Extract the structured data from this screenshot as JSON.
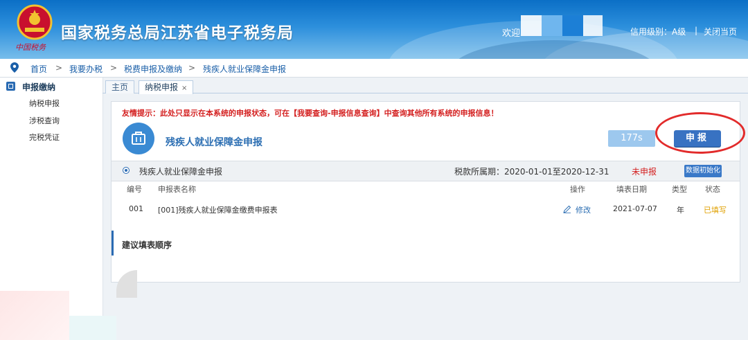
{
  "header": {
    "site_title": "国家税务总局江苏省电子税务局",
    "slogan": "中国税务",
    "welcome": "欢迎",
    "credit": "信用级别：A级",
    "separator": "|",
    "close_page": "关闭当页"
  },
  "breadcrumb": {
    "items": [
      "首页",
      "我要办税",
      "税费申报及缴纳",
      "残疾人就业保障金申报"
    ],
    "sep": ">"
  },
  "sidebar": {
    "heading": "申报缴纳",
    "items": [
      "纳税申报",
      "涉税查询",
      "完税凭证"
    ]
  },
  "tabs": [
    {
      "label": "主页"
    },
    {
      "label": "纳税申报",
      "close": "×"
    }
  ],
  "panel": {
    "tip": "友情提示：此处只显示在本系统的申报状态，可在【我要查询-申报信息查询】中查询其他所有系统的申报信息！",
    "title": "残疾人就业保障金申报",
    "timer": "177s",
    "submit": "申报",
    "section": {
      "title": "残疾人就业保障金申报",
      "period": "税款所属期：2020-01-01至2020-12-31",
      "status": "未申报",
      "init_button": "数据初始化"
    },
    "table": {
      "headers": [
        "编号",
        "申报表名称",
        "操作",
        "填表日期",
        "类型",
        "状态"
      ],
      "rows": [
        {
          "id": "001",
          "name": "[001]残疾人就业保障金缴费申报表",
          "action": "修改",
          "date": "2021-07-07",
          "type": "年",
          "status": "已填写"
        }
      ]
    },
    "suggest": "建议填表顺序"
  },
  "colors": {
    "accent": "#2a6bb3",
    "warning": "#d42020",
    "filled": "#e0a000"
  }
}
